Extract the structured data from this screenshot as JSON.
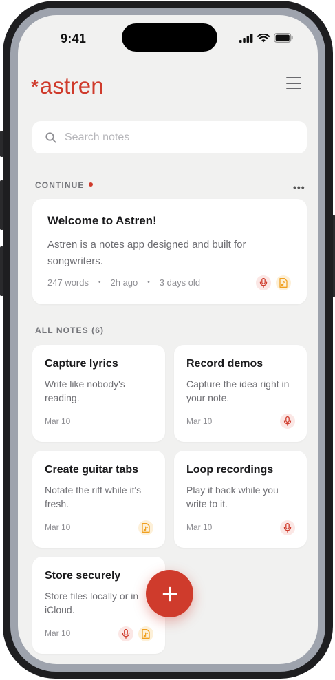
{
  "status": {
    "time": "9:41"
  },
  "app": {
    "logo_mark": "*",
    "name": "astren"
  },
  "search": {
    "placeholder": "Search notes"
  },
  "continue_section": {
    "label": "CONTINUE",
    "more": "•••"
  },
  "featured": {
    "title": "Welcome to Astren!",
    "description": "Astren is a notes app designed and built for songwriters.",
    "words": "247 words",
    "edited": "2h ago",
    "age": "3 days old",
    "sep": "•",
    "badges": [
      "mic-icon",
      "guitar-tab-icon"
    ]
  },
  "all_notes": {
    "label": "ALL NOTES (6)",
    "notes": [
      {
        "title": "Capture lyrics",
        "description": "Write like nobody's reading.",
        "date": "Mar 10",
        "badges": []
      },
      {
        "title": "Record demos",
        "description": "Capture the idea right in your note.",
        "date": "Mar 10",
        "badges": [
          "mic-icon"
        ]
      },
      {
        "title": "Create guitar tabs",
        "description": "Notate the riff while it's fresh.",
        "date": "Mar 10",
        "badges": [
          "guitar-tab-icon"
        ]
      },
      {
        "title": "Loop recordings",
        "description": "Play it back while you write to it.",
        "date": "Mar 10",
        "badges": [
          "mic-icon"
        ]
      },
      {
        "title": "Store securely",
        "description": "Store files locally or in iCloud.",
        "date": "Mar 10",
        "badges": [
          "mic-icon",
          "guitar-tab-icon"
        ]
      }
    ]
  },
  "colors": {
    "accent": "#cf3b2c",
    "mic_badge": "#fbe7e5",
    "tab_badge": "#fdf0d8",
    "tab_icon": "#f0a020"
  }
}
